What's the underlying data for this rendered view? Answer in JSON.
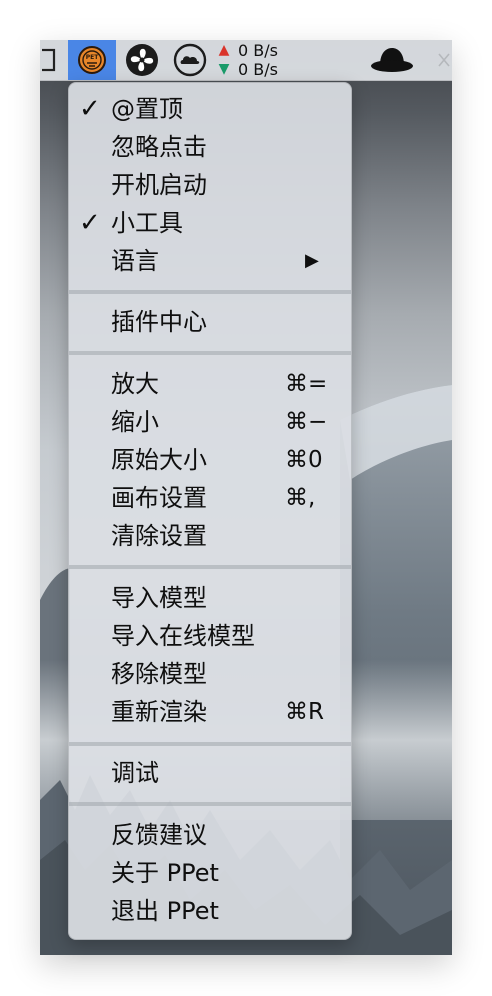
{
  "menubar": {
    "items": [
      {
        "id": "window-icon",
        "interactable": true
      },
      {
        "id": "ppet-icon",
        "interactable": true,
        "active": true
      },
      {
        "id": "fan-icon",
        "interactable": true
      },
      {
        "id": "cloud-icon",
        "interactable": true
      }
    ],
    "net": {
      "up": "0 B/s",
      "down": "0 B/s",
      "up_color": "#d9342b",
      "down_color": "#1a9b6a"
    },
    "hat_icon": "bowler-hat-icon",
    "close_icon": "close-icon"
  },
  "menu": {
    "items": [
      {
        "label": "@置顶",
        "check": "✓",
        "shortcut": "",
        "submenu": false
      },
      {
        "label": "忽略点击",
        "check": "",
        "shortcut": "",
        "submenu": false
      },
      {
        "label": "开机启动",
        "check": "",
        "shortcut": "",
        "submenu": false
      },
      {
        "label": "小工具",
        "check": "✓",
        "shortcut": "",
        "submenu": false
      },
      {
        "label": "语言",
        "check": "",
        "shortcut": "",
        "submenu": true,
        "arrow": "▶"
      },
      {
        "label": "插件中心",
        "check": "",
        "shortcut": "",
        "submenu": false
      },
      {
        "label": "放大",
        "check": "",
        "shortcut": "⌘=",
        "submenu": false
      },
      {
        "label": "缩小",
        "check": "",
        "shortcut": "⌘−",
        "submenu": false
      },
      {
        "label": "原始大小",
        "check": "",
        "shortcut": "⌘0",
        "submenu": false
      },
      {
        "label": "画布设置",
        "check": "",
        "shortcut": "⌘,",
        "submenu": false
      },
      {
        "label": "清除设置",
        "check": "",
        "shortcut": "",
        "submenu": false
      },
      {
        "label": "导入模型",
        "check": "",
        "shortcut": "",
        "submenu": false
      },
      {
        "label": "导入在线模型",
        "check": "",
        "shortcut": "",
        "submenu": false
      },
      {
        "label": "移除模型",
        "check": "",
        "shortcut": "",
        "submenu": false
      },
      {
        "label": "重新渲染",
        "check": "",
        "shortcut": "⌘R",
        "submenu": false
      },
      {
        "label": "调试",
        "check": "",
        "shortcut": "",
        "submenu": false
      },
      {
        "label": "反馈建议",
        "check": "",
        "shortcut": "",
        "submenu": false
      },
      {
        "label": "关于 PPet",
        "check": "",
        "shortcut": "",
        "submenu": false
      },
      {
        "label": "退出 PPet",
        "check": "",
        "shortcut": "",
        "submenu": false
      }
    ]
  },
  "colors": {
    "accent": "#4a86e6",
    "ppet_badge": "#e8862a"
  }
}
